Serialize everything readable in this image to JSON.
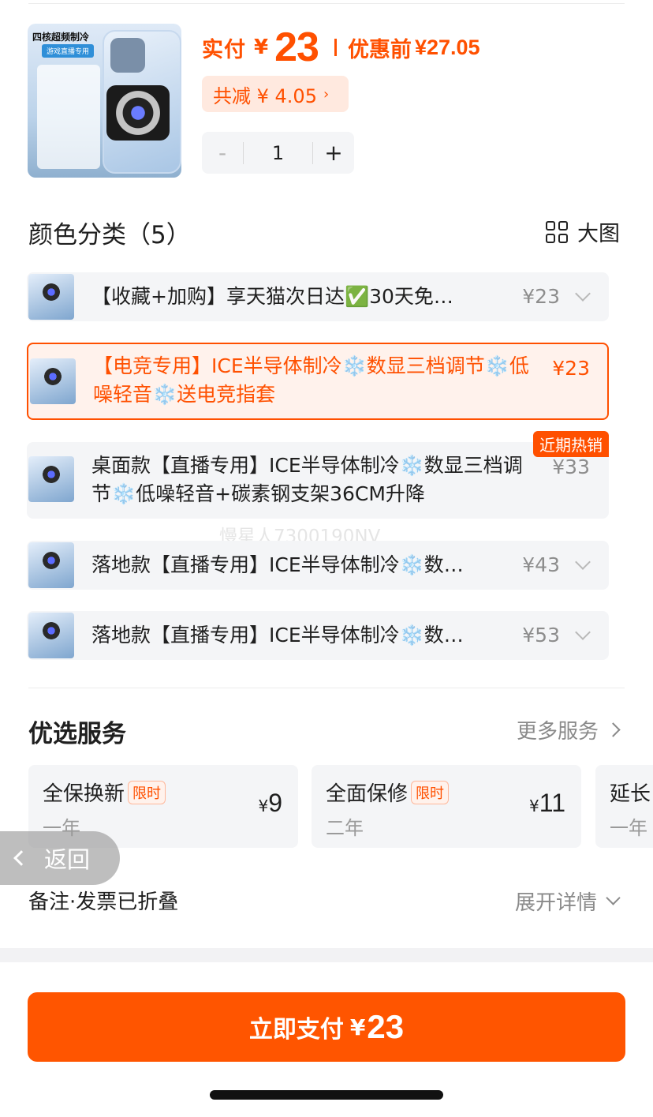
{
  "product": {
    "thumb_title": "四核超频制冷",
    "thumb_tag": "游戏直播专用",
    "price_prefix": "实付",
    "currency": "¥",
    "price": "23",
    "orig_label": "优惠前",
    "orig_price": "¥27.05",
    "discount": "共减 ¥ 4.05",
    "quantity": "1",
    "minus": "-",
    "plus": "+"
  },
  "color_section": {
    "title": "颜色分类（5）",
    "bigview": "大图"
  },
  "options": [
    {
      "text": "【收藏+加购】享天猫次日达✅30天免…",
      "price": "¥23"
    },
    {
      "text": "【电竞专用】ICE半导体制冷❄️数显三档调节❄️低噪轻音❄️送电竞指套",
      "price": "¥23"
    },
    {
      "text": "桌面款【直播专用】ICE半导体制冷❄️数显三档调节❄️低噪轻音+碳素钢支架36CM升降",
      "price": "¥33",
      "badge": "近期热销"
    },
    {
      "text": "落地款【直播专用】ICE半导体制冷❄️数…",
      "price": "¥43"
    },
    {
      "text": "落地款【直播专用】ICE半导体制冷❄️数…",
      "price": "¥53"
    }
  ],
  "watermark": "慢星人7300190NV",
  "services": {
    "title": "优选服务",
    "more": "更多服务",
    "items": [
      {
        "name": "全保换新",
        "tag": "限时",
        "term": "一年",
        "currency": "¥",
        "price": "9"
      },
      {
        "name": "全面保修",
        "tag": "限时",
        "term": "二年",
        "currency": "¥",
        "price": "11"
      },
      {
        "name": "延长",
        "term": "一年"
      }
    ]
  },
  "back": "返回",
  "note": {
    "label": "备注·发票已折叠",
    "expand": "展开详情"
  },
  "pay": {
    "label": "立即支付",
    "currency": "¥",
    "amount": "23"
  },
  "colors": {
    "accent": "#ff5000",
    "pay_button": "#ff5500"
  }
}
